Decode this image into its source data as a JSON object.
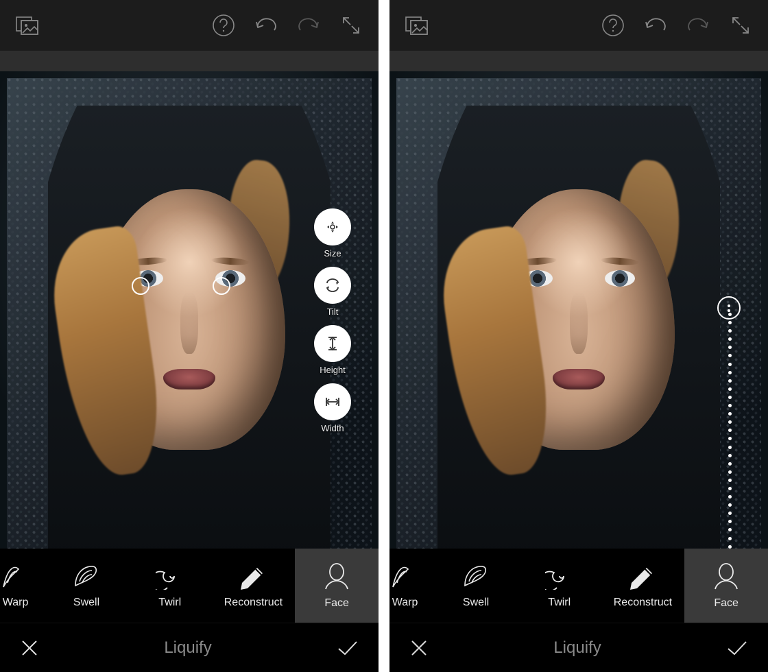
{
  "topbar": {
    "icons": {
      "compare": "compare-original-icon",
      "help": "help-icon",
      "undo": "undo-icon",
      "redo": "redo-icon",
      "fullscreen": "fullscreen-icon"
    }
  },
  "face_tools": [
    {
      "id": "size",
      "label": "Size",
      "icon": "size-icon"
    },
    {
      "id": "tilt",
      "label": "Tilt",
      "icon": "tilt-icon"
    },
    {
      "id": "height",
      "label": "Height",
      "icon": "height-icon"
    },
    {
      "id": "width",
      "label": "Width",
      "icon": "width-icon"
    }
  ],
  "liquify_tools": [
    {
      "id": "warp",
      "label": "Warp",
      "selected": false
    },
    {
      "id": "swell",
      "label": "Swell",
      "selected": false
    },
    {
      "id": "twirl",
      "label": "Twirl",
      "selected": false
    },
    {
      "id": "reconstruct",
      "label": "Reconstruct",
      "selected": false
    },
    {
      "id": "face",
      "label": "Face",
      "selected": true
    }
  ],
  "bottom": {
    "title": "Liquify",
    "cancel": "cancel-icon",
    "confirm": "confirm-icon"
  }
}
